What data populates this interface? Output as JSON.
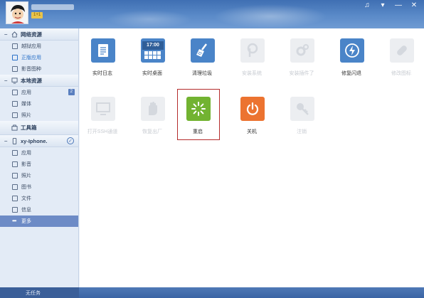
{
  "header": {
    "user_badge": "1+1"
  },
  "window_controls": {
    "music_glyph": "♫",
    "menu_glyph": "▾",
    "minimize_glyph": "—",
    "close_glyph": "✕"
  },
  "sidebar": {
    "network": {
      "title": "网络资源",
      "items": [
        "越狱应用",
        "正版应用",
        "影音图种"
      ]
    },
    "local": {
      "title": "本地资源",
      "items": [
        "应用",
        "媒体",
        "照片"
      ],
      "app_count": "2"
    },
    "toolbox": {
      "title": "工具箱"
    },
    "device": {
      "title": "xy-Iphone.",
      "items": [
        "应用",
        "影音",
        "照片",
        "图书",
        "文件",
        "信息",
        "更多"
      ]
    }
  },
  "tiles": {
    "realtime_log": "实时日志",
    "realtime_desktop": "实时桌面",
    "clean_junk": "清理垃圾",
    "install_system": "安装系统",
    "install_plugin": "安装插件了",
    "repair_crash": "修复闪退",
    "repair_icons": "修改图标",
    "open_ssh": "打开SSH通道",
    "recovery": "恢复出厂",
    "restart": "重启",
    "shutdown": "关机",
    "logout": "注销",
    "clock_text": "17:00"
  },
  "status": {
    "text": "无任务"
  },
  "colors": {
    "header_blue": "#4a7bbd",
    "tile_blue": "#4a84c8",
    "restart_green": "#72b331",
    "shutdown_orange": "#ec7330",
    "highlight_red": "#b42b2b"
  }
}
